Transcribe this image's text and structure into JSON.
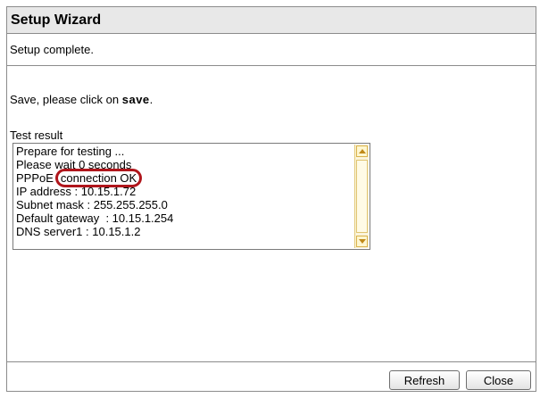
{
  "window": {
    "title": "Setup Wizard"
  },
  "status": {
    "message": "Setup complete."
  },
  "instruction": {
    "prefix": "Save, please click on ",
    "keyword": "save",
    "suffix": "."
  },
  "test_result": {
    "label": "Test result",
    "lines": [
      "Prepare for testing ...",
      "Please wait 0 seconds",
      "IP address : 10.15.1.72",
      "Subnet mask : 255.255.255.0",
      "Default gateway  : 10.15.1.254",
      "DNS server1 : 10.15.1.2"
    ],
    "pppoe_prefix": "PPPoE",
    "pppoe_status": "connection OK",
    "highlight_color": "#b0161c"
  },
  "buttons": {
    "refresh_label": "Refresh",
    "close_label": "Close"
  },
  "icons": {
    "scroll_up": "scroll-up-arrow-icon",
    "scroll_down": "scroll-down-arrow-icon"
  }
}
